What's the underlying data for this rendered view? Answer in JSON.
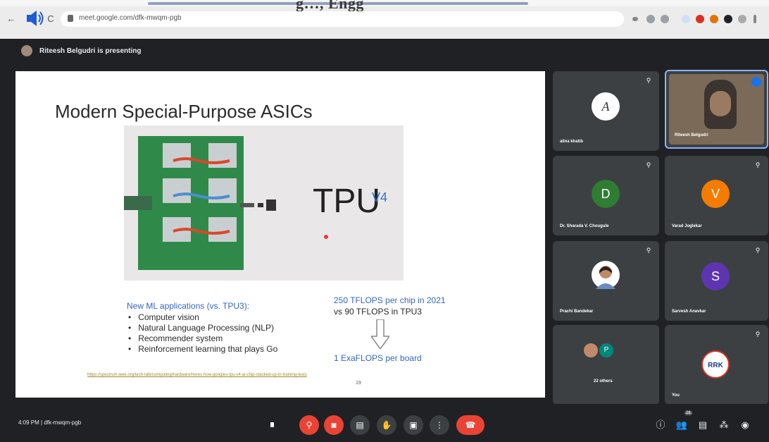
{
  "browser": {
    "title_fragment": "g…, Engg",
    "url": "meet.google.com/dfk-mwqm-pgb",
    "nav_back": "←",
    "nav_reload": "C"
  },
  "meet": {
    "presenting_text": "Riteesh Belgudri is presenting",
    "slide": {
      "title": "Modern Special-Purpose ASICs",
      "tpu_text": "TPU",
      "tpu_version": "V4",
      "apps_heading": "New ML applications (vs. TPU3):",
      "apps": [
        "Computer vision",
        "Natural Language Processing (NLP)",
        "Recommender system",
        "Reinforcement learning that plays Go"
      ],
      "flops_line1": "250 TFLOPS per chip in 2021",
      "flops_line2": "vs 90 TFLOPS in TPU3",
      "exaflops": "1 ExaFLOPS per board",
      "source_link": "https://spectrum.ieee.org/tech-talk/computing/hardware/heres-how-googles-tpu-v4-ai-chip-stacked-up-in-training-tests",
      "page_number": "19"
    },
    "participants": [
      {
        "name": "alina khatib",
        "avatar_letter": "A",
        "avatar_color": "#ffffff"
      },
      {
        "name": "Riteesh Belgudri",
        "avatar_letter": "",
        "avatar_color": ""
      },
      {
        "name": "Dr. Sharada V. Chougule",
        "avatar_letter": "D",
        "avatar_color": "#2e7d32"
      },
      {
        "name": "Varad Joglekar",
        "avatar_letter": "V",
        "avatar_color": "#f57c00"
      },
      {
        "name": "Prachi Bandekar",
        "avatar_letter": "",
        "avatar_color": ""
      },
      {
        "name": "Sarvesh Anavkar",
        "avatar_letter": "S",
        "avatar_color": "#5e35b1"
      },
      {
        "name": "22 others",
        "avatar_letter": "P",
        "avatar_color": "#00897b"
      },
      {
        "name": "You",
        "avatar_letter": "RRK",
        "avatar_color": "#ffffff"
      }
    ],
    "bottom": {
      "time_and_code": "4:09 PM  |  dfk-mwqm-pgb",
      "participants_count": "28"
    }
  },
  "colors": {
    "accent_blue": "#3565c7",
    "hangup_red": "#ea4335",
    "meet_bg": "#202124",
    "tile_bg": "#3c4043"
  }
}
